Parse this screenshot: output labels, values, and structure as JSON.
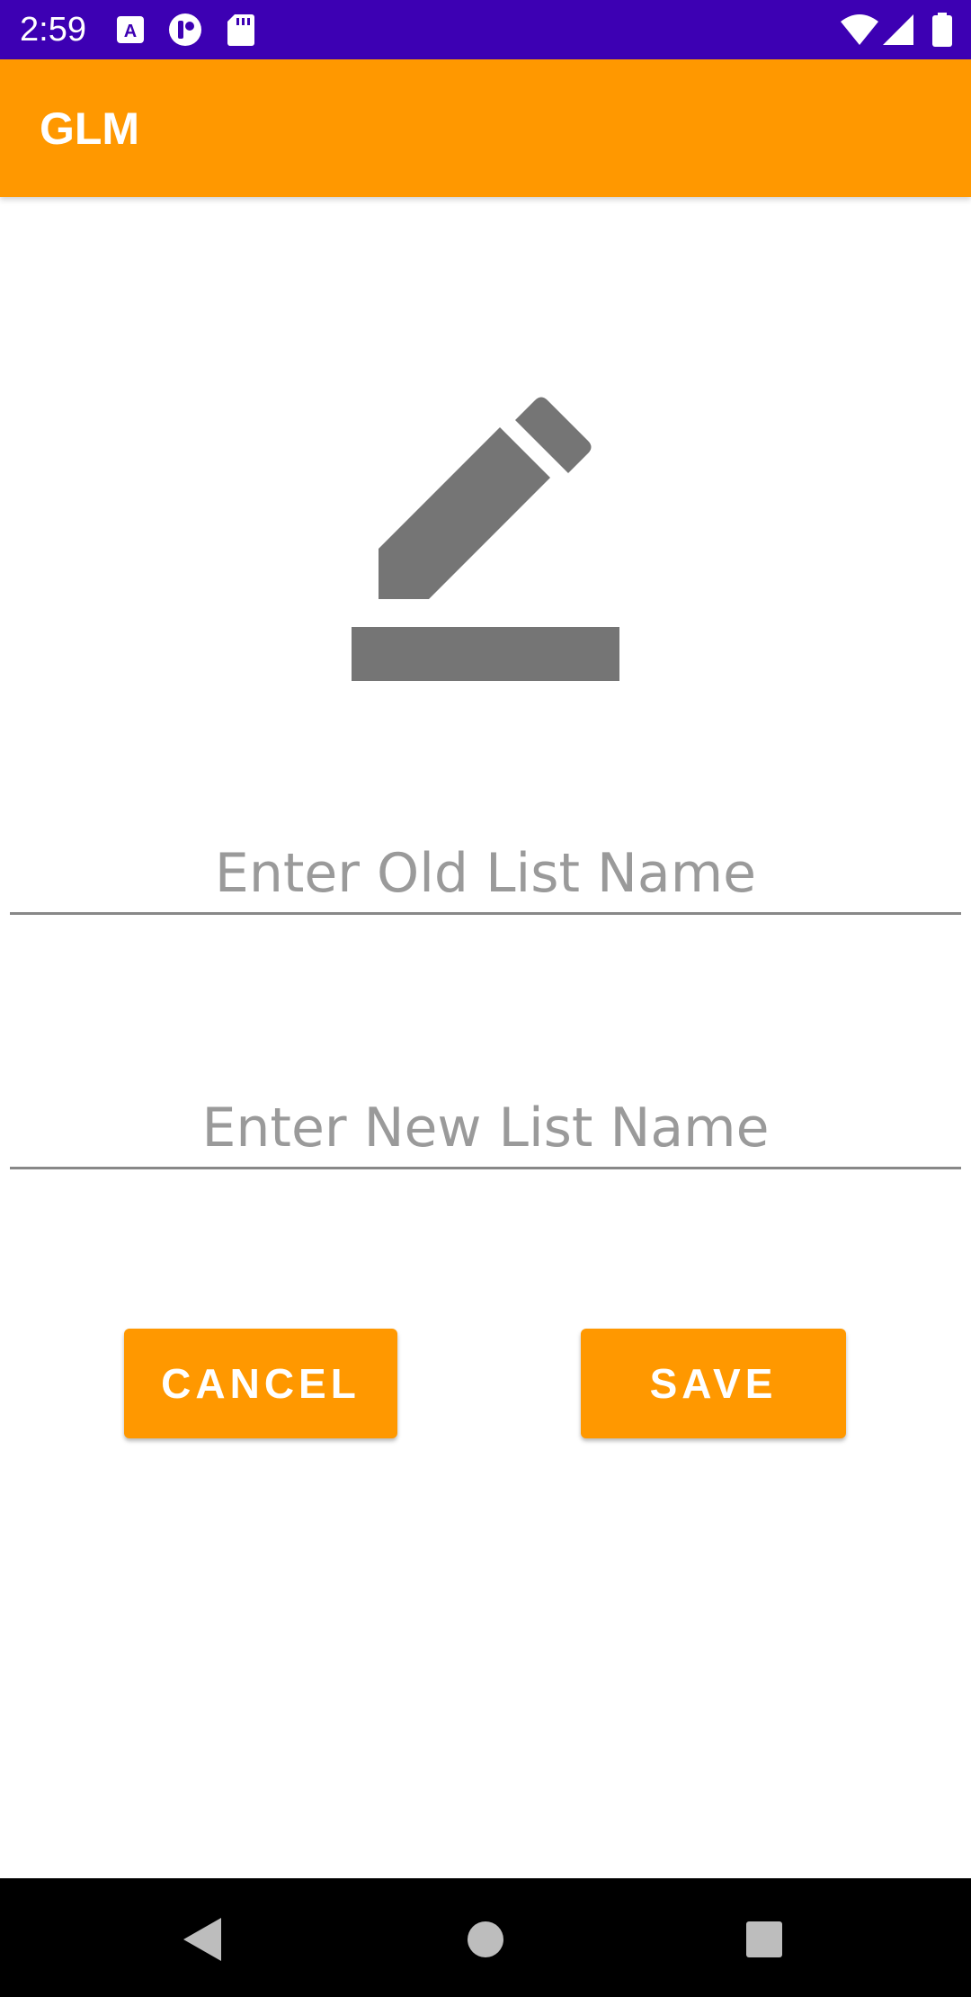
{
  "status_bar": {
    "time": "2:59",
    "background": "#3d00b3",
    "icons": [
      "a11y-icon",
      "pocket-icon",
      "sd-card-icon",
      "wifi-icon",
      "signal-icon",
      "battery-icon"
    ]
  },
  "app_bar": {
    "title": "GLM",
    "background": "#ff9800"
  },
  "hero_icon": "edit-pencil-icon",
  "form": {
    "old_name": {
      "value": "",
      "placeholder": "Enter Old List Name"
    },
    "new_name": {
      "value": "",
      "placeholder": "Enter New List Name"
    }
  },
  "actions": {
    "cancel_label": "CANCEL",
    "save_label": "SAVE",
    "accent": "#ff9800"
  },
  "nav_bar": {
    "buttons": [
      "back-icon",
      "home-icon",
      "recents-icon"
    ]
  }
}
